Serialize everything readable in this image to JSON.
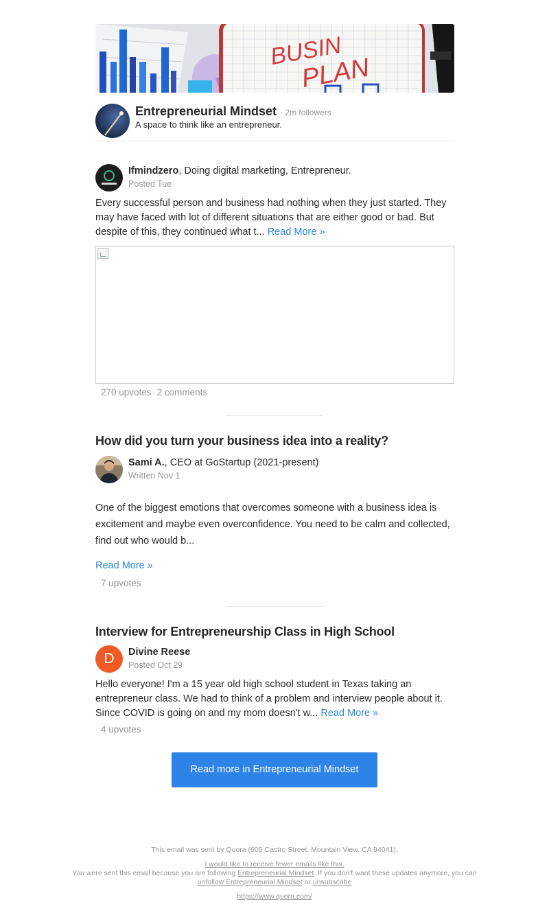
{
  "space": {
    "name": "Entrepreneurial Mindset",
    "followers": "· 2m followers",
    "description": "A space to think like an entrepreneur.",
    "banner_text_line1": "BUSIN",
    "banner_text_line2": "PLAN"
  },
  "posts": [
    {
      "author": "Ifmindzero",
      "credential": ", Doing digital marketing, Entrepreneur.",
      "meta": "Posted Tue",
      "text": "Every successful person and business had nothing when they just started. They may have faced with lot of different situations that are either good or bad. But despite of this, they continued what t...",
      "read_more": "Read More »",
      "upvotes": "270 upvotes",
      "comments": "2 comments"
    },
    {
      "title": "How did you turn your business idea into a reality?",
      "author": "Sami A.",
      "credential": ", CEO at GoStartup (2021-present)",
      "meta": "Written Nov 1",
      "text": "One of the biggest emotions that overcomes someone with a business idea is excitement and maybe even overconfidence. You need to be calm and collected, find out who would b...",
      "read_more": "Read More »",
      "upvotes": "7 upvotes"
    },
    {
      "title": "Interview for Entrepreneurship Class in High School",
      "author": "Divine Reese",
      "avatar_letter": "D",
      "meta": "Posted Oct 29",
      "text": "Hello everyone! I'm a 15 year old high school student in Texas taking an entrepreneur class. We had to think of a problem and interview people about it. Since COVID is going on and my mom doesn't w...",
      "read_more": "Read More »",
      "upvotes": "4 upvotes"
    }
  ],
  "cta": {
    "label": "Read more in Entrepreneurial Mindset"
  },
  "footer": {
    "sent_by": "This email was sent by Quora (605 Castro Street, Mountain View, CA 94041).",
    "fewer_emails": "I would like to receive fewer emails like this.",
    "reason_prefix": "You were sent this email because you are following ",
    "reason_link": "Entrepreneurial Mindset",
    "reason_suffix": ". If you don't want these updates anymore, you can ",
    "unfollow_link": "unfollow Entrepreneurial Mindset",
    "or": " or ",
    "unsubscribe_link": "unsubscribe",
    "site_link": "https://www.quora.com/"
  },
  "colors": {
    "accent": "#2b87d9",
    "cta_bg": "#2e83e6",
    "avatar_orange": "#f05a24",
    "muted": "#939598"
  }
}
